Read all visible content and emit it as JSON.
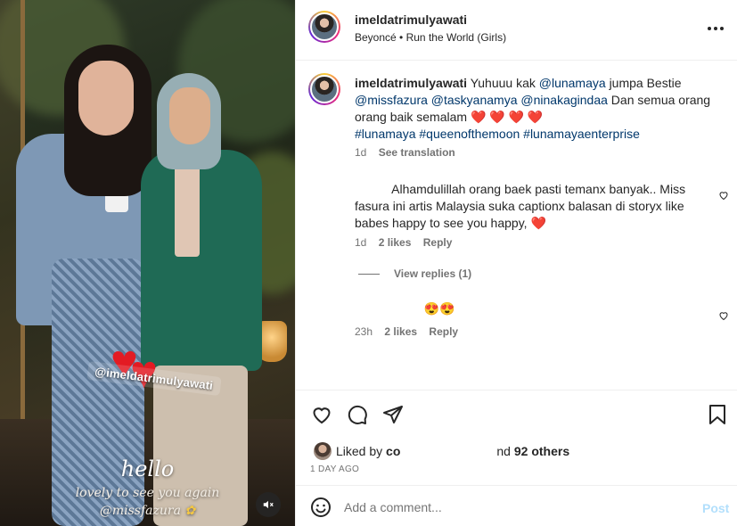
{
  "post": {
    "username": "imeldatrimulyawati",
    "audio_artist": "Beyoncé",
    "audio_separator": "•",
    "audio_track": "Run the World (Girls)",
    "more_icon": "more-horizontal-icon"
  },
  "media": {
    "sticker_mention": "@imeldatrimulyawati",
    "story_hello": "hello",
    "story_line1": "lovely to see you again",
    "story_line2": "@missfazura",
    "mute_icon": "speaker-muted-icon"
  },
  "caption": {
    "username": "imeldatrimulyawati",
    "text_1": "Yuhuuu kak",
    "mention_1": "@lunamaya",
    "text_2": "jumpa Bestie",
    "mention_2": "@missfazura",
    "mention_3": "@taskyanamya",
    "mention_4": "@ninakagindaa",
    "text_3": "Dan semua orang orang baik semalam",
    "hearts": "❤️ ❤️ ❤️ ❤️",
    "hashtag_1": "#lunamaya",
    "hashtag_2": "#queenofthemoon",
    "hashtag_3": "#lunamayaenterprise",
    "time": "1d",
    "translate": "See translation"
  },
  "comments": [
    {
      "text": "Alhamdulillah orang baek pasti temanx banyak.. Miss fasura ini artis Malaysia suka captionx balasan di storyx like babes happy to see you happy,",
      "emoji": "❤️",
      "time": "1d",
      "likes": "2 likes",
      "reply": "Reply",
      "view_replies": "View replies (1)"
    },
    {
      "text": "😍😍",
      "time": "23h",
      "likes": "2 likes",
      "reply": "Reply"
    }
  ],
  "actions": {
    "liked_by_prefix": "Liked by",
    "liked_by_user": "co",
    "liked_by_and": "nd",
    "others": "92 others",
    "timestamp": "1 DAY AGO"
  },
  "add_comment": {
    "placeholder": "Add a comment...",
    "post_label": "Post"
  },
  "colors": {
    "link": "#00376b",
    "muted": "#737373",
    "post_button_disabled": "#b2dffc",
    "heart": "#e0245e"
  }
}
